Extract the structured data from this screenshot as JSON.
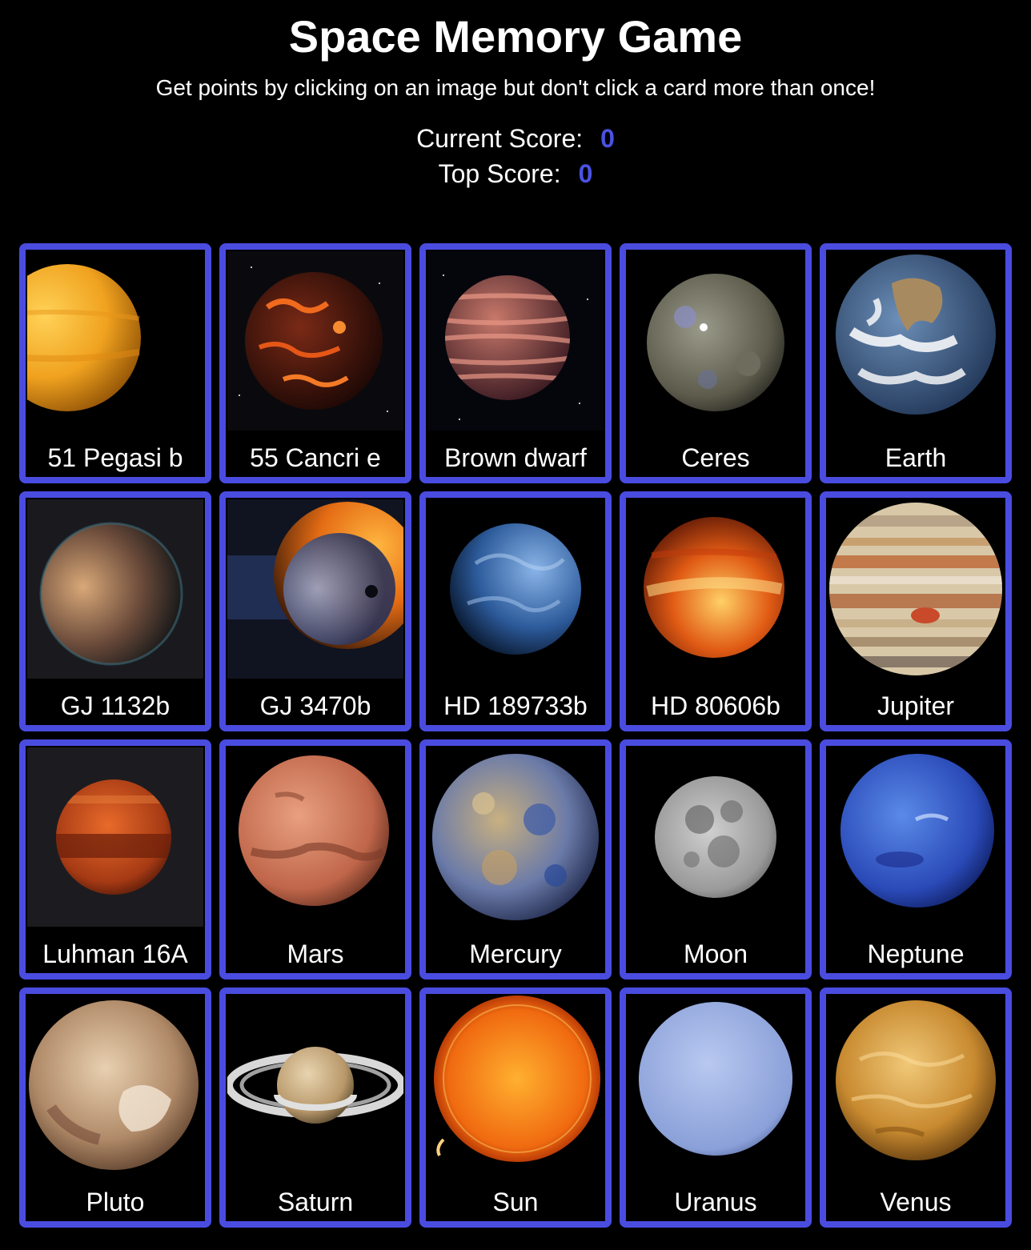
{
  "header": {
    "title": "Space Memory Game",
    "subtitle": "Get points by clicking on an image but don't click a card more than once!",
    "current_label": "Current Score:",
    "current_value": "0",
    "top_label": "Top Score:",
    "top_value": "0"
  },
  "colors": {
    "accent": "#4a4ce0",
    "score": "#4a52e3",
    "background": "#000000"
  },
  "cards": [
    {
      "label": "51 Pegasi b",
      "icon": "51-pegasi-b-icon"
    },
    {
      "label": "55 Cancri e",
      "icon": "55-cancri-e-icon"
    },
    {
      "label": "Brown dwarf",
      "icon": "brown-dwarf-icon"
    },
    {
      "label": "Ceres",
      "icon": "ceres-icon"
    },
    {
      "label": "Earth",
      "icon": "earth-icon"
    },
    {
      "label": "GJ 1132b",
      "icon": "gj-1132b-icon"
    },
    {
      "label": "GJ 3470b",
      "icon": "gj-3470b-icon"
    },
    {
      "label": "HD 189733b",
      "icon": "hd-189733b-icon"
    },
    {
      "label": "HD 80606b",
      "icon": "hd-80606b-icon"
    },
    {
      "label": "Jupiter",
      "icon": "jupiter-icon"
    },
    {
      "label": "Luhman 16A",
      "icon": "luhman-16a-icon"
    },
    {
      "label": "Mars",
      "icon": "mars-icon"
    },
    {
      "label": "Mercury",
      "icon": "mercury-icon"
    },
    {
      "label": "Moon",
      "icon": "moon-icon"
    },
    {
      "label": "Neptune",
      "icon": "neptune-icon"
    },
    {
      "label": "Pluto",
      "icon": "pluto-icon"
    },
    {
      "label": "Saturn",
      "icon": "saturn-icon"
    },
    {
      "label": "Sun",
      "icon": "sun-icon"
    },
    {
      "label": "Uranus",
      "icon": "uranus-icon"
    },
    {
      "label": "Venus",
      "icon": "venus-icon"
    }
  ]
}
